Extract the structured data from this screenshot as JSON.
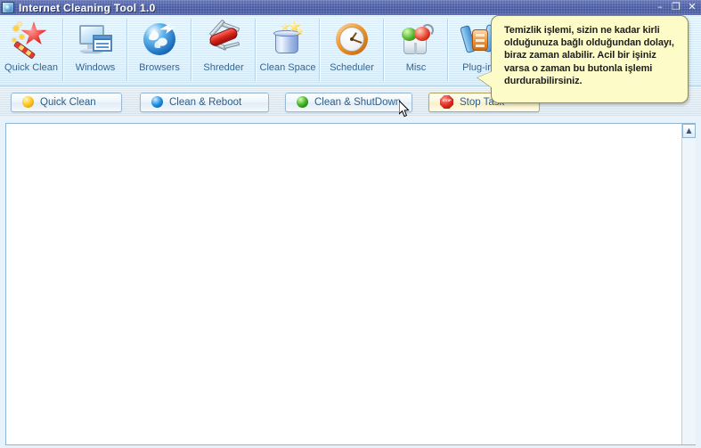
{
  "window": {
    "title": "Internet Cleaning Tool 1.0",
    "icon": "globe-app-icon",
    "controls": {
      "minimize": "–",
      "maximize": "❐",
      "close": "✕"
    }
  },
  "toolbar": {
    "items": [
      {
        "label": "Quick Clean",
        "icon": "magic-wand-icon"
      },
      {
        "label": "Windows",
        "icon": "monitor-window-icon"
      },
      {
        "label": "Browsers",
        "icon": "globe-icon"
      },
      {
        "label": "Shredder",
        "icon": "swiss-army-knife-icon"
      },
      {
        "label": "Clean Space",
        "icon": "sparkling-bin-icon"
      },
      {
        "label": "Scheduler",
        "icon": "clock-icon"
      },
      {
        "label": "Misc",
        "icon": "tooth-brush-icon"
      },
      {
        "label": "Plug-ins",
        "icon": "wrench-plugin-icon"
      }
    ]
  },
  "actions": {
    "buttons": [
      {
        "label": "Quick Clean",
        "icon": "yellow-dot-icon"
      },
      {
        "label": "Clean & Reboot",
        "icon": "blue-dot-icon"
      },
      {
        "label": "Clean & ShutDown",
        "icon": "green-dot-icon"
      },
      {
        "label": "Stop Task",
        "icon": "stop-sign-icon"
      }
    ]
  },
  "tooltip": {
    "text": "Temizlik işlemi, sizin ne kadar kirli olduğunuza bağlı olduğundan dolayı, biraz zaman alabilir. Acil bir işiniz varsa o zaman bu butonla işlemi durdurabilirsiniz."
  },
  "content": {
    "text": ""
  },
  "scrollbar": {
    "up_arrow": "▲",
    "down_arrow": "▼"
  },
  "colors": {
    "titlebar": "#4f61a8",
    "toolbar_bg": "#dcecf8",
    "label_blue": "#36658f",
    "tooltip_bg": "#fdfbc8",
    "stop_red": "#dd2a1d"
  }
}
